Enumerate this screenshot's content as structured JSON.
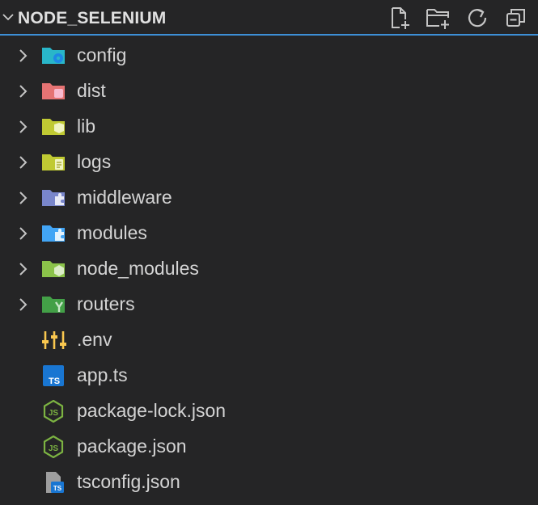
{
  "explorer": {
    "title": "NODE_SELENIUM",
    "actions": [
      {
        "name": "new-file-icon"
      },
      {
        "name": "new-folder-icon"
      },
      {
        "name": "refresh-icon"
      },
      {
        "name": "collapse-all-icon"
      }
    ]
  },
  "tree": {
    "items": [
      {
        "label": "config",
        "type": "folder",
        "icon": "config-folder-icon",
        "color": "#29b6c9"
      },
      {
        "label": "dist",
        "type": "folder",
        "icon": "dist-folder-icon",
        "color": "#ef7b7b"
      },
      {
        "label": "lib",
        "type": "folder",
        "icon": "lib-folder-icon",
        "color": "#c0ca33"
      },
      {
        "label": "logs",
        "type": "folder",
        "icon": "logs-folder-icon",
        "color": "#c0ca33"
      },
      {
        "label": "middleware",
        "type": "folder",
        "icon": "middleware-folder-icon",
        "color": "#7986cb"
      },
      {
        "label": "modules",
        "type": "folder",
        "icon": "modules-folder-icon",
        "color": "#42a5f5"
      },
      {
        "label": "node_modules",
        "type": "folder",
        "icon": "node-modules-folder-icon",
        "color": "#8bc34a"
      },
      {
        "label": "routers",
        "type": "folder",
        "icon": "routers-folder-icon",
        "color": "#43a047"
      },
      {
        "label": ".env",
        "type": "file",
        "icon": "env-file-icon",
        "color": "#f9c74f"
      },
      {
        "label": "app.ts",
        "type": "file",
        "icon": "typescript-file-icon",
        "color": "#1976d2"
      },
      {
        "label": "package-lock.json",
        "type": "file",
        "icon": "nodejs-file-icon",
        "color": "#7cb342"
      },
      {
        "label": "package.json",
        "type": "file",
        "icon": "nodejs-file-icon",
        "color": "#7cb342"
      },
      {
        "label": "tsconfig.json",
        "type": "file",
        "icon": "tsconfig-file-icon",
        "color": "#1976d2"
      }
    ]
  },
  "colors": {
    "background": "#252526",
    "accent_border": "#3d8fd6",
    "text": "#d4d4d4"
  }
}
